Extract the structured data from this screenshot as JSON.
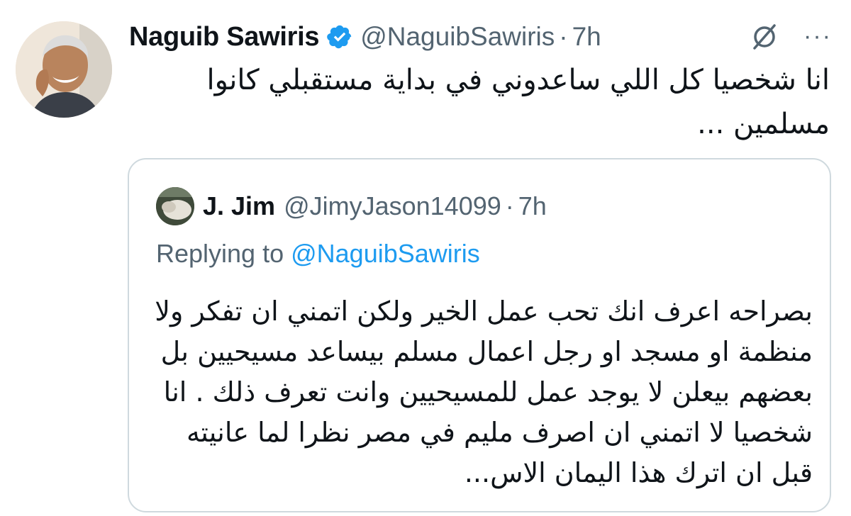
{
  "tweet": {
    "author_name": "Naguib Sawiris",
    "author_handle": "@NaguibSawiris",
    "separator": "·",
    "time": "7h",
    "text": "انا شخصيا كل اللي ساعدوني في بداية مستقبلي كانوا مسلمين ...",
    "avatar_icon": "profile-photo",
    "verified_icon": "verified-badge-icon",
    "colors": {
      "verified": "#1d9bf0",
      "secondary_text": "#536471"
    }
  },
  "quoted_tweet": {
    "author_name": "J. Jim",
    "author_handle": "@JimyJason14099",
    "separator": "·",
    "time": "7h",
    "replying_prefix": "Replying to ",
    "replying_handle": "@NaguibSawiris",
    "text": "بصراحه اعرف انك تحب عمل الخير ولكن اتمني ان تفكر ولا منظمة او مسجد او رجل اعمال مسلم بيساعد مسيحيين بل بعضهم بيعلن لا يوجد عمل للمسيحيين وانت تعرف ذلك . انا شخصيا لا اتمني ان اصرف مليم في مصر نظرا لما عانيته قبل ان اترك هذا اليمان الاس...",
    "colors": {
      "mention": "#1d9bf0",
      "border": "#cfd9de"
    }
  }
}
